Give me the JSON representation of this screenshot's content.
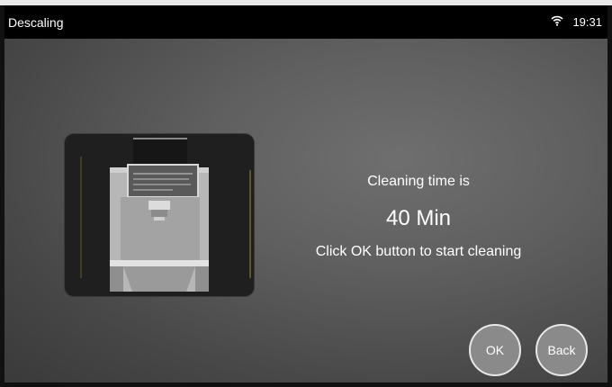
{
  "statusbar": {
    "title": "Descaling",
    "time": "19:31",
    "wifi_icon": "wifi-icon"
  },
  "illustration": {
    "icon": "coffee-machine-icon"
  },
  "message": {
    "line1": "Cleaning time is",
    "duration": "40 Min",
    "line3": "Click OK button to start cleaning"
  },
  "buttons": {
    "ok_label": "OK",
    "back_label": "Back"
  },
  "colors": {
    "statusbar_bg": "#000000",
    "button_fill": "#8a8a8a",
    "button_border": "#e8e8e8"
  }
}
